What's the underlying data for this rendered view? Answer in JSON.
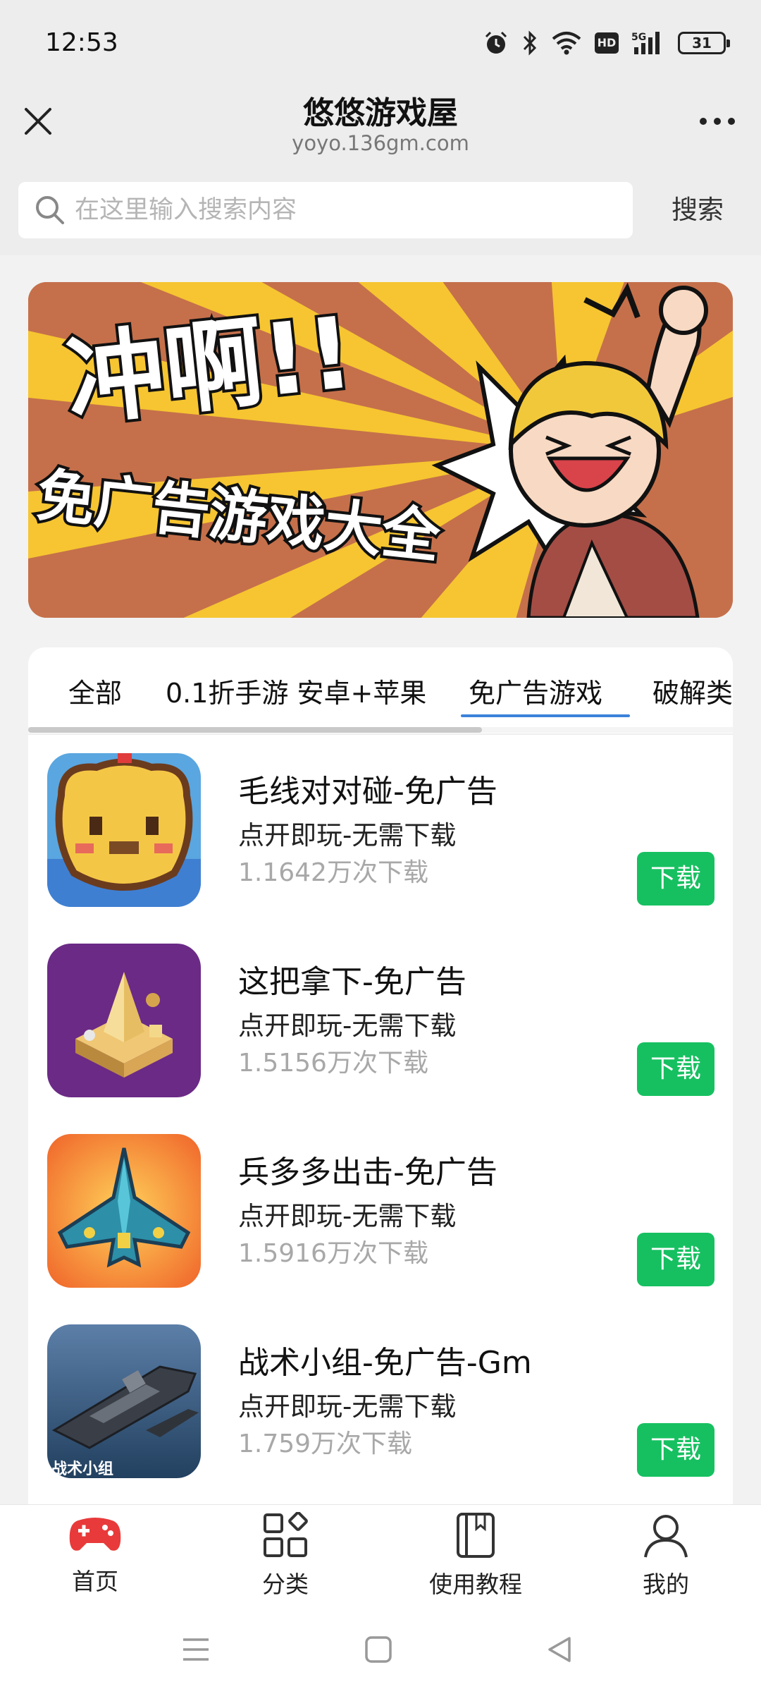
{
  "status_bar": {
    "time": "12:53",
    "battery": "31",
    "icons": [
      "alarm-icon",
      "bluetooth-icon",
      "wifi-icon",
      "hd-icon",
      "5g-signal-icon",
      "battery-icon"
    ]
  },
  "title_bar": {
    "title": "悠悠游戏屋",
    "url": "yoyo.136gm.com",
    "close_icon": "close-icon",
    "more_icon": "more-icon"
  },
  "search": {
    "placeholder": "在这里输入搜索内容",
    "button_label": "搜索"
  },
  "banner": {
    "line1": "冲啊!!",
    "line2": "免广告游戏大全"
  },
  "tabs": {
    "items": [
      "全部",
      "0.1折手游 安卓+苹果",
      "免广告游戏",
      "破解类"
    ],
    "active_index": 2
  },
  "games": [
    {
      "title": "毛线对对碰-免广告",
      "subtitle": "点开即玩-无需下载",
      "downloads": "1.1642万次下载",
      "button": "下载"
    },
    {
      "title": "这把拿下-免广告",
      "subtitle": "点开即玩-无需下载",
      "downloads": "1.5156万次下载",
      "button": "下载"
    },
    {
      "title": "兵多多出击-免广告",
      "subtitle": "点开即玩-无需下载",
      "downloads": "1.5916万次下载",
      "button": "下载"
    },
    {
      "title": "战术小组-免广告-Gm",
      "subtitle": "点开即玩-无需下载",
      "downloads": "1.759万次下载",
      "button": "下载",
      "icon_caption": "战术小组"
    }
  ],
  "bottom_nav": [
    {
      "label": "首页",
      "icon": "gamepad-icon",
      "color": "#e83a3a"
    },
    {
      "label": "分类",
      "icon": "category-icon",
      "color": "#333333"
    },
    {
      "label": "使用教程",
      "icon": "book-icon",
      "color": "#333333"
    },
    {
      "label": "我的",
      "icon": "user-icon",
      "color": "#333333"
    }
  ],
  "colors": {
    "download_green": "#16c060",
    "tab_active": "#3b82d9",
    "home_red": "#e83a3a"
  }
}
